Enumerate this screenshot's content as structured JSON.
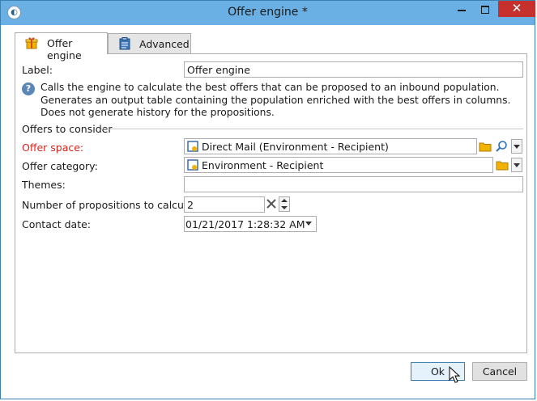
{
  "window": {
    "title": "Offer engine *",
    "close_glyph": "✕"
  },
  "tabs": [
    {
      "label": "Offer engine",
      "icon": "gift-icon",
      "active": true
    },
    {
      "label": "Advanced",
      "icon": "clipboard-icon",
      "active": false
    }
  ],
  "form": {
    "label_caption": "Label:",
    "label_value": "Offer engine",
    "info_text": "Calls the engine to calculate the best offers that can be proposed to an inbound population. Generates an output table containing the population enriched with the best offers in columns. Does not generate history for the propositions.",
    "section_title": "Offers to consider",
    "offer_space_caption": "Offer space:",
    "offer_space_value": "Direct Mail (Environment - Recipient)",
    "offer_category_caption": "Offer category:",
    "offer_category_value": "Environment - Recipient",
    "themes_caption": "Themes:",
    "themes_value": "",
    "propositions_caption": "Number of propositions to calculate:",
    "propositions_value": "2",
    "contact_date_caption": "Contact date:",
    "contact_date_value": "01/21/2017 1:28:32 AM"
  },
  "buttons": {
    "ok": "Ok",
    "cancel": "Cancel"
  },
  "colors": {
    "titlebar": "#6ab0e4",
    "close": "#c7312d",
    "required_label": "#d9251d",
    "folder": "#f2b200"
  }
}
